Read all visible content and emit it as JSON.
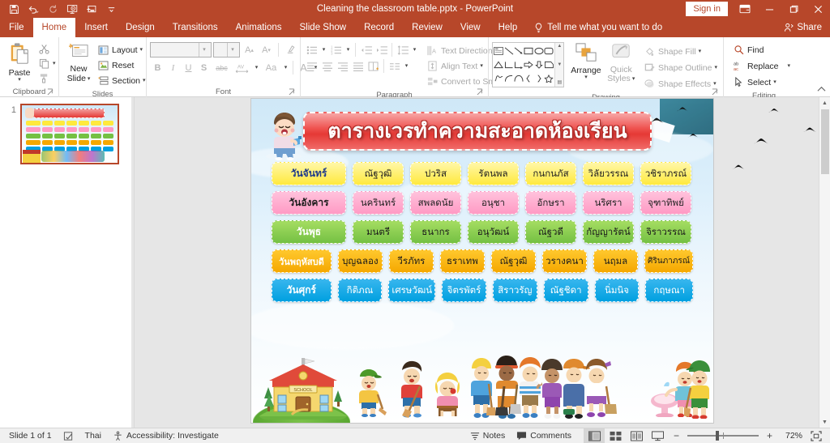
{
  "titlebar": {
    "document_title": "Cleaning the classroom table.pptx  -  PowerPoint",
    "signin_label": "Sign in",
    "qat": [
      {
        "name": "save-icon",
        "label": "Save"
      },
      {
        "name": "undo-icon",
        "label": "Undo"
      },
      {
        "name": "redo-icon",
        "label": "Redo"
      },
      {
        "name": "start-from-beginning-icon",
        "label": "Start From Beginning"
      },
      {
        "name": "new-slide-qat-icon",
        "label": "New Slide"
      },
      {
        "name": "customize-qat-icon",
        "label": "Customize Quick Access Toolbar"
      }
    ],
    "window_buttons": {
      "ribbon_display_options": "Ribbon Display Options",
      "minimize": "Minimize",
      "restore": "Restore Down",
      "close": "Close"
    }
  },
  "tabs": [
    {
      "label": "File",
      "active": false
    },
    {
      "label": "Home",
      "active": true
    },
    {
      "label": "Insert",
      "active": false
    },
    {
      "label": "Design",
      "active": false
    },
    {
      "label": "Transitions",
      "active": false
    },
    {
      "label": "Animations",
      "active": false
    },
    {
      "label": "Slide Show",
      "active": false
    },
    {
      "label": "Record",
      "active": false
    },
    {
      "label": "Review",
      "active": false
    },
    {
      "label": "View",
      "active": false
    },
    {
      "label": "Help",
      "active": false
    }
  ],
  "tellme": {
    "placeholder": "Tell me what you want to do",
    "icon": "lightbulb-icon"
  },
  "share": {
    "label": "Share",
    "icon": "share-person-icon"
  },
  "ribbon": {
    "clipboard": {
      "group_label": "Clipboard",
      "paste_label": "Paste",
      "cut_label": "Cut",
      "copy_label": "Copy",
      "format_painter_label": "Format Painter"
    },
    "slides": {
      "group_label": "Slides",
      "new_slide_label": "New\nSlide",
      "new_slide_line1": "New",
      "new_slide_line2": "Slide",
      "layout_label": "Layout",
      "reset_label": "Reset",
      "section_label": "Section"
    },
    "font": {
      "group_label": "Font",
      "font_name_value": "",
      "font_size_value": "",
      "increase_font_label": "Increase Font Size",
      "decrease_font_label": "Decrease Font Size",
      "clear_formatting_label": "Clear All Formatting",
      "bold": "B",
      "italic": "I",
      "underline": "U",
      "shadow": "S",
      "strikethrough": "abc",
      "character_spacing": "AV",
      "change_case": "Aa",
      "font_color": "A"
    },
    "paragraph": {
      "group_label": "Paragraph",
      "text_direction_label": "Text Direction",
      "align_text_label": "Align Text",
      "convert_smartart_label": "Convert to SmartArt"
    },
    "drawing": {
      "group_label": "Drawing",
      "arrange_label": "Arrange",
      "quick_styles_line1": "Quick",
      "quick_styles_line2": "Styles",
      "shape_fill_label": "Shape Fill",
      "shape_outline_label": "Shape Outline",
      "shape_effects_label": "Shape Effects"
    },
    "editing": {
      "group_label": "Editing",
      "find_label": "Find",
      "replace_label": "Replace",
      "select_label": "Select"
    }
  },
  "thumbnails": [
    {
      "number": "1",
      "selected": true
    }
  ],
  "slide": {
    "title": "ตารางเวรทำความสะอาดห้องเรียน",
    "rows": [
      {
        "color_key": "r-yellow",
        "accent": "#ffe93d",
        "day": "วันจันทร์",
        "names": [
          "ณัฐวุฒิ",
          "ปวริส",
          "รัตนพล",
          "กนกนภัส",
          "วิลัยวรรณ",
          "วชิราภรณ์"
        ]
      },
      {
        "color_key": "r-pink",
        "accent": "#ff9ac4",
        "day": "วันอังคาร",
        "names": [
          "นครินทร์",
          "สพลดนัย",
          "อนุชา",
          "อักษรา",
          "นริศรา",
          "จุฑาทิพย์"
        ]
      },
      {
        "color_key": "r-green",
        "accent": "#74c043",
        "day": "วันพุธ",
        "names": [
          "มนตรี",
          "ธนากร",
          "อนุวัฒน์",
          "ณัฐวดี",
          "กัญญารัตน์",
          "จิราวรรณ"
        ]
      },
      {
        "color_key": "r-orange",
        "accent": "#f5a800",
        "day": "วันพฤหัสบดี",
        "names": [
          "บุญฉลอง",
          "วีรภัทร",
          "ธราเทพ",
          "ณัฐวุฒิ",
          "วรางคนา",
          "นฤมล",
          "ศิรินภาภรณ์"
        ]
      },
      {
        "color_key": "r-blue",
        "accent": "#00a0e0",
        "day": "วันศุกร์",
        "names": [
          "กิติภณ",
          "เศรษวัฒน์",
          "จิตรพัตร์",
          "สิราวรัญ",
          "ณัฐชิดา",
          "นิ่มนิจ",
          "กฤษณา"
        ]
      }
    ],
    "school_sign": "SCHOOL"
  },
  "statusbar": {
    "slide_counter": "Slide 1 of 1",
    "notes_icon_label": "Spelling",
    "language": "Thai",
    "accessibility": "Accessibility: Investigate",
    "notes_label": "Notes",
    "comments_label": "Comments",
    "views": [
      {
        "name": "normal-view-button",
        "active": true
      },
      {
        "name": "slide-sorter-view-button",
        "active": false
      },
      {
        "name": "reading-view-button",
        "active": false
      },
      {
        "name": "slide-show-button",
        "active": false
      }
    ],
    "zoom_out": "−",
    "zoom_in": "+",
    "zoom_value": "72%",
    "fit_to_window_label": "Fit slide to current window"
  }
}
